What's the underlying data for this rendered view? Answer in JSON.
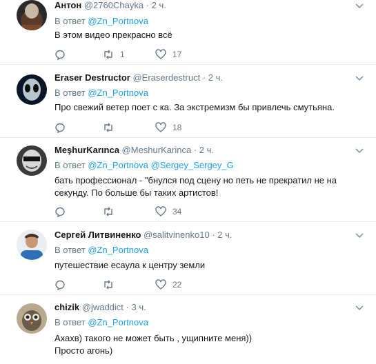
{
  "tweets": [
    {
      "name": "Антон",
      "handle": "@2760Chayka",
      "dot": "·",
      "time": "2 ч.",
      "reply_prefix": "В ответ",
      "mentions": [
        "@Zn_Portnova"
      ],
      "text_lines": [
        "В этом видео прекрасно всё"
      ],
      "retweets": "1",
      "likes": "17",
      "avatar": "dark-alien-avatar"
    },
    {
      "name": "Eraser Destructor",
      "handle": "@Eraserdestruct",
      "dot": "·",
      "time": "2 ч.",
      "reply_prefix": "В ответ",
      "mentions": [
        "@Zn_Portnova"
      ],
      "text_lines": [
        "Про свежий ветер поет с ка. За экстремизм бы привлечь смутьяна."
      ],
      "retweets": "",
      "likes": "18",
      "avatar": "alien-avatar"
    },
    {
      "name": "MeşhurKarınca",
      "handle": "@MeshurKarinca",
      "dot": "·",
      "time": "2 ч.",
      "reply_prefix": "В ответ",
      "mentions": [
        "@Zn_Portnova",
        "@Sergey_Sergey_G"
      ],
      "text_lines": [
        "бать профессионал - \"бнулся под сцену но петь не прекратил не на",
        "секунду. По больше бы таких артистов!"
      ],
      "retweets": "",
      "likes": "34",
      "avatar": "sunglasses-avatar"
    },
    {
      "name": "Сергей Литвиненко",
      "handle": "@salitvinenko10",
      "dot": "·",
      "time": "2 ч.",
      "reply_prefix": "В ответ",
      "mentions": [
        "@Zn_Portnova"
      ],
      "text_lines": [
        "путешествие есаула к центру земли"
      ],
      "retweets": "",
      "likes": "22",
      "avatar": "man-avatar"
    },
    {
      "name": "chizik",
      "handle": "@jwaddict",
      "dot": "·",
      "time": "3 ч.",
      "reply_prefix": "В ответ",
      "mentions": [
        "@Zn_Portnova"
      ],
      "text_lines": [
        "Ахахв) такого не может быть , ущипните меня))",
        "Просто агонь)"
      ],
      "retweets": "",
      "likes": "",
      "avatar": "owl-avatar"
    }
  ],
  "colors": {
    "link": "#1da1f2",
    "secondary": "#657786",
    "text": "#14171a",
    "divider": "#e6ecf0"
  }
}
